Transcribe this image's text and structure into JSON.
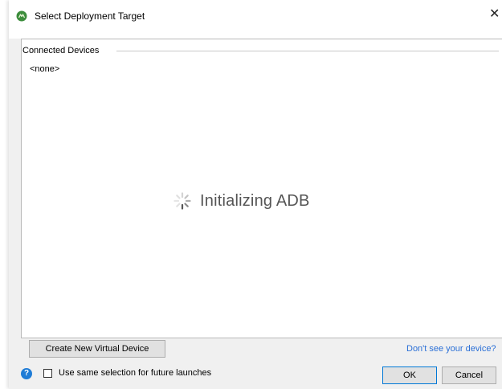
{
  "window": {
    "title": "Select Deployment Target",
    "close_glyph": "✕",
    "app_icon": "xamarin-android-icon"
  },
  "devices": {
    "section_label": "Connected Devices",
    "empty_text": "<none>"
  },
  "status": {
    "text": "Initializing ADB",
    "icon": "spinner-icon"
  },
  "actions": {
    "create_label": "Create New Virtual Device",
    "help_link": "Don't see your device?",
    "ok_label": "OK",
    "cancel_label": "Cancel"
  },
  "options": {
    "help_glyph": "?",
    "same_selection_label": "Use same selection for future launches",
    "same_selection_checked": false
  },
  "colors": {
    "link": "#2a6fd6",
    "help_icon": "#1f7cd6",
    "ok_border": "#0078d7"
  }
}
